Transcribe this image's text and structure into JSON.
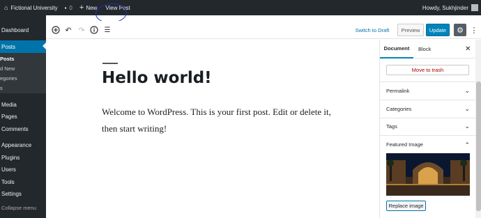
{
  "admin_bar": {
    "site_name": "Fictional University",
    "comments_count": "0",
    "new_label": "New",
    "view_post_label": "View Post",
    "howdy": "Howdy, Sukhjinder"
  },
  "sidebar": {
    "dashboard": "Dashboard",
    "posts": "Posts",
    "sub_items": [
      "Posts",
      "d New",
      "egories",
      "s"
    ],
    "media": "Media",
    "pages": "Pages",
    "comments": "Comments",
    "appearance": "Appearance",
    "plugins": "Plugins",
    "users": "Users",
    "tools": "Tools",
    "settings": "Settings",
    "collapse": "Collapse menu"
  },
  "toolbar": {
    "switch_to_draft": "Switch to Draft",
    "preview": "Preview",
    "update": "Update"
  },
  "post": {
    "title": "Hello world!",
    "body": "Welcome to WordPress. This is your first post. Edit or delete it, then start writing!"
  },
  "panel": {
    "tab_document": "Document",
    "tab_block": "Block",
    "move_to_trash": "Move to trash",
    "permalink": "Permalink",
    "categories": "Categories",
    "tags": "Tags",
    "featured_image": "Featured Image",
    "replace_image": "Replace image"
  },
  "colors": {
    "admin_dark": "#23282d",
    "accent": "#0073aa",
    "trash_red": "#a00"
  }
}
